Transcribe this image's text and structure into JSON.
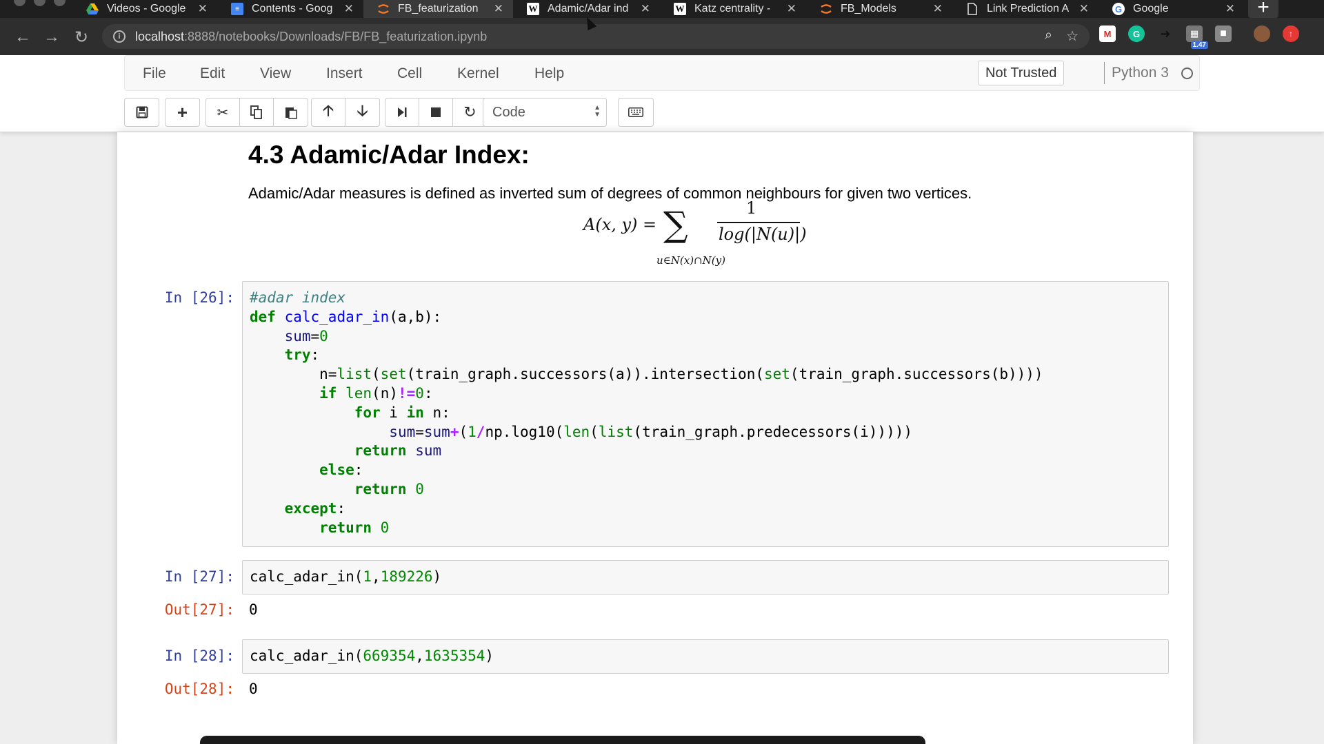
{
  "browser": {
    "tabs": [
      {
        "label": "Videos - Google",
        "icon": "google-drive-icon",
        "active": false
      },
      {
        "label": "Contents - Goog",
        "icon": "google-docs-icon",
        "active": false
      },
      {
        "label": "FB_featurization",
        "icon": "jupyter-icon",
        "active": true
      },
      {
        "label": "Adamic/Adar ind",
        "icon": "wikipedia-icon",
        "active": false
      },
      {
        "label": "Katz centrality -",
        "icon": "wikipedia-icon",
        "active": false
      },
      {
        "label": "FB_Models",
        "icon": "jupyter-icon",
        "active": false
      },
      {
        "label": "Link Prediction A",
        "icon": "document-icon",
        "active": false
      },
      {
        "label": "Google",
        "icon": "google-icon",
        "active": false
      }
    ],
    "url_host": "localhost",
    "url_rest": ":8888/notebooks/Downloads/FB/FB_featurization.ipynb",
    "extension_badge": "1.47"
  },
  "jupyter": {
    "menu": [
      "File",
      "Edit",
      "View",
      "Insert",
      "Cell",
      "Kernel",
      "Help"
    ],
    "trust_label": "Not Trusted",
    "kernel_name": "Python 3",
    "cell_type": "Code"
  },
  "notebook": {
    "heading": "4.3 Adamic/Adar Index:",
    "description": "Adamic/Adar measures is defined as inverted sum of degrees of common neighbours for given two vertices.",
    "formula": {
      "lhs": "A(x, y) =",
      "sigma": "∑",
      "subscript": "u∈N(x)∩N(y)",
      "numerator": "1",
      "denominator": "log(|N(u)|)"
    },
    "cells": [
      {
        "prompt": "In [26]:"
      },
      {
        "prompt": "In [27]:",
        "output_prompt": "Out[27]:",
        "output": "0"
      },
      {
        "prompt": "In [28]:",
        "output_prompt": "Out[28]:",
        "output": "0"
      }
    ]
  },
  "colors": {
    "in_prompt": "#303f9f",
    "out_prompt": "#d84315",
    "keyword": "#008000",
    "def_name": "#0000ff"
  }
}
